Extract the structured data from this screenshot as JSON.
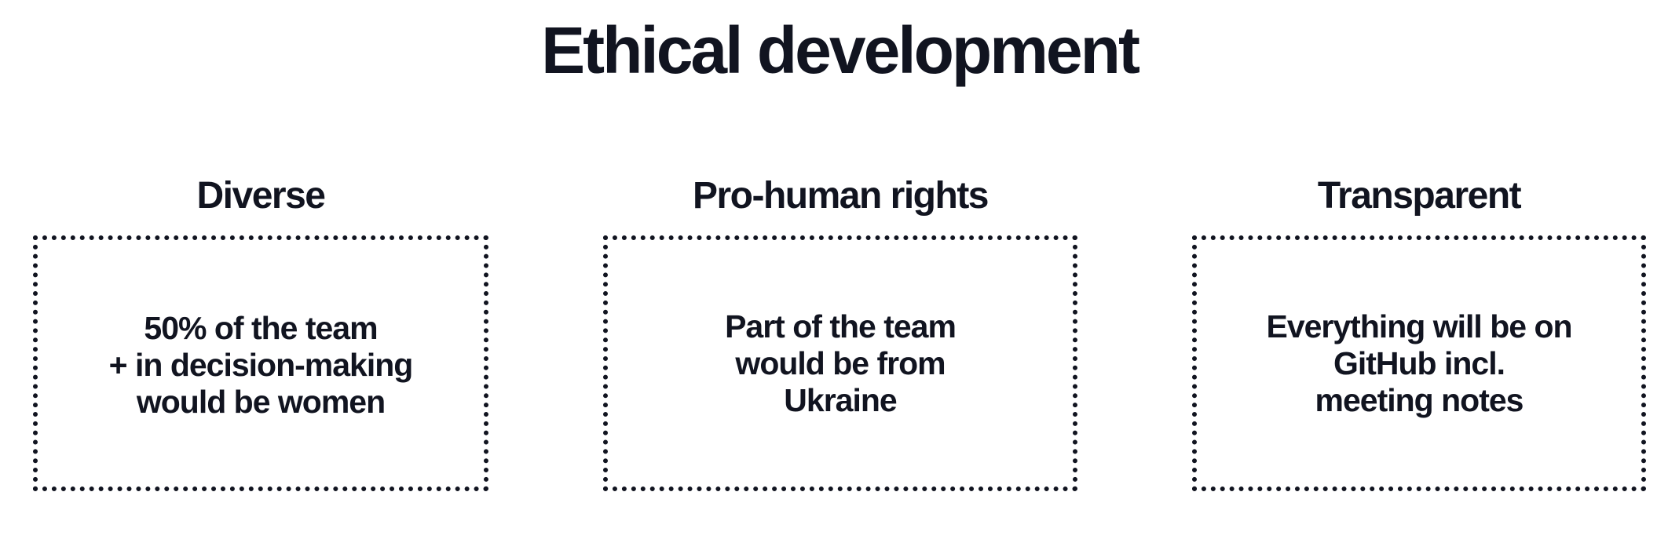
{
  "page": {
    "title": "Ethical development"
  },
  "columns": [
    {
      "heading": "Diverse",
      "body": "50% of the team\n+ in decision-making\nwould be women"
    },
    {
      "heading": "Pro-human rights",
      "body": "Part of the team\nwould be from\nUkraine"
    },
    {
      "heading": "Transparent",
      "body": "Everything will be on\nGitHub incl.\nmeeting notes"
    }
  ],
  "colors": {
    "text": "#111420",
    "background": "#ffffff",
    "border": "#111420"
  }
}
